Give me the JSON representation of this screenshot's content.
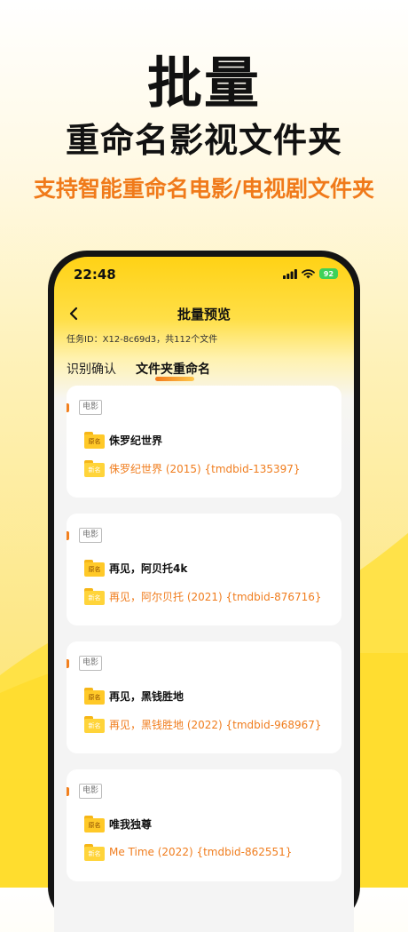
{
  "hero": {
    "title": "批量",
    "subtitle": "重命名影视文件夹",
    "tagline": "支持智能重命名电影/电视剧文件夹"
  },
  "status_bar": {
    "time": "22:48",
    "battery": "92"
  },
  "nav": {
    "title": "批量预览"
  },
  "task_info": "任务ID：X12-8c69d3，共112个文件",
  "tabs": [
    {
      "label": "识别确认",
      "active": false
    },
    {
      "label": "文件夹重命名",
      "active": true
    }
  ],
  "folder_labels": {
    "original": "原名",
    "new": "新名"
  },
  "items": [
    {
      "tag": "电影",
      "original": "侏罗纪世界",
      "renamed": "侏罗纪世界 (2015) {tmdbid-135397}"
    },
    {
      "tag": "电影",
      "original": "再见，阿贝托4k",
      "renamed": "再见，阿尔贝托 (2021) {tmdbid-876716}"
    },
    {
      "tag": "电影",
      "original": "再见，黑钱胜地",
      "renamed": "再见，黑钱胜地 (2022) {tmdbid-968967}"
    },
    {
      "tag": "电影",
      "original": "唯我独尊",
      "renamed": "Me Time (2022) {tmdbid-862551}"
    }
  ],
  "colors": {
    "accent_orange": "#f07a1a",
    "header_yellow": "#ffd215",
    "folder_yellow": "#ffc928",
    "battery_green": "#3ed158"
  },
  "icons": [
    "back-chevron-icon",
    "signal-icon",
    "wifi-icon",
    "battery-icon",
    "folder-icon"
  ]
}
